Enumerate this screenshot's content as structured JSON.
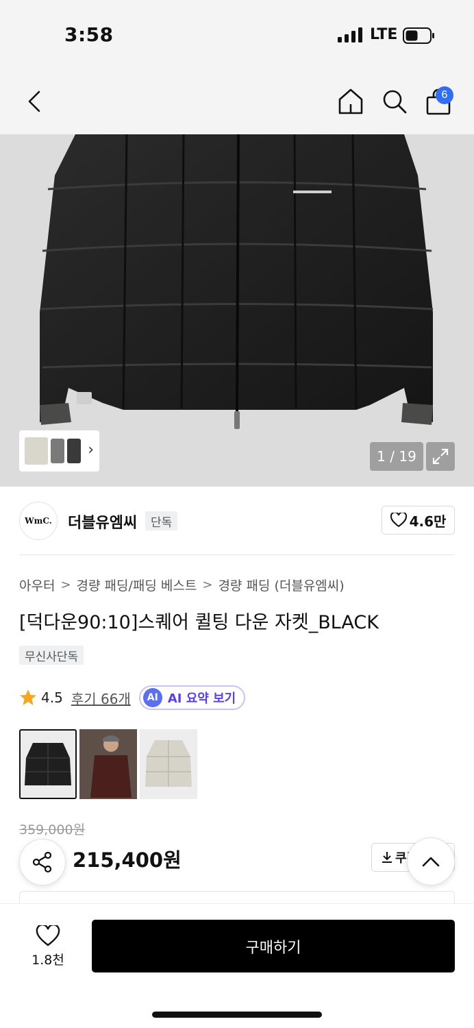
{
  "status_bar": {
    "time": "3:58",
    "network": "LTE",
    "battery_icon": "battery-icon",
    "signal_icon": "signal-icon"
  },
  "nav": {
    "cart_badge": "6",
    "icons": [
      "back-chevron-icon",
      "home-icon",
      "search-icon",
      "cart-bag-icon"
    ]
  },
  "gallery": {
    "counter": "1 / 19",
    "thumb_chevron": "›"
  },
  "brand": {
    "logo_text": "WmC.",
    "name": "더블유엠씨",
    "tag": "단독",
    "likes": "4.6만"
  },
  "breadcrumb": [
    "아우터",
    "경량 패딩/패딩 베스트",
    "경량 패딩 (더블유엠씨)"
  ],
  "product": {
    "title": "[덕다운90:10]스퀘어 퀼팅 다운 자켓_BLACK",
    "tag": "무신사단독",
    "rating": "4.5",
    "reviews": "후기 66개",
    "ai_badge": "AI",
    "ai_label": "AI 요약 보기"
  },
  "price": {
    "original": "359,000원",
    "sale": "215,400원",
    "coupon_label": "쿠폰"
  },
  "bottom_bar": {
    "wish_count": "1.8천",
    "buy_label": "구매하기"
  },
  "colors": {
    "accent_blue": "#2f6ef5",
    "ai_purple": "#5b3ef0",
    "star": "#f5a623"
  }
}
